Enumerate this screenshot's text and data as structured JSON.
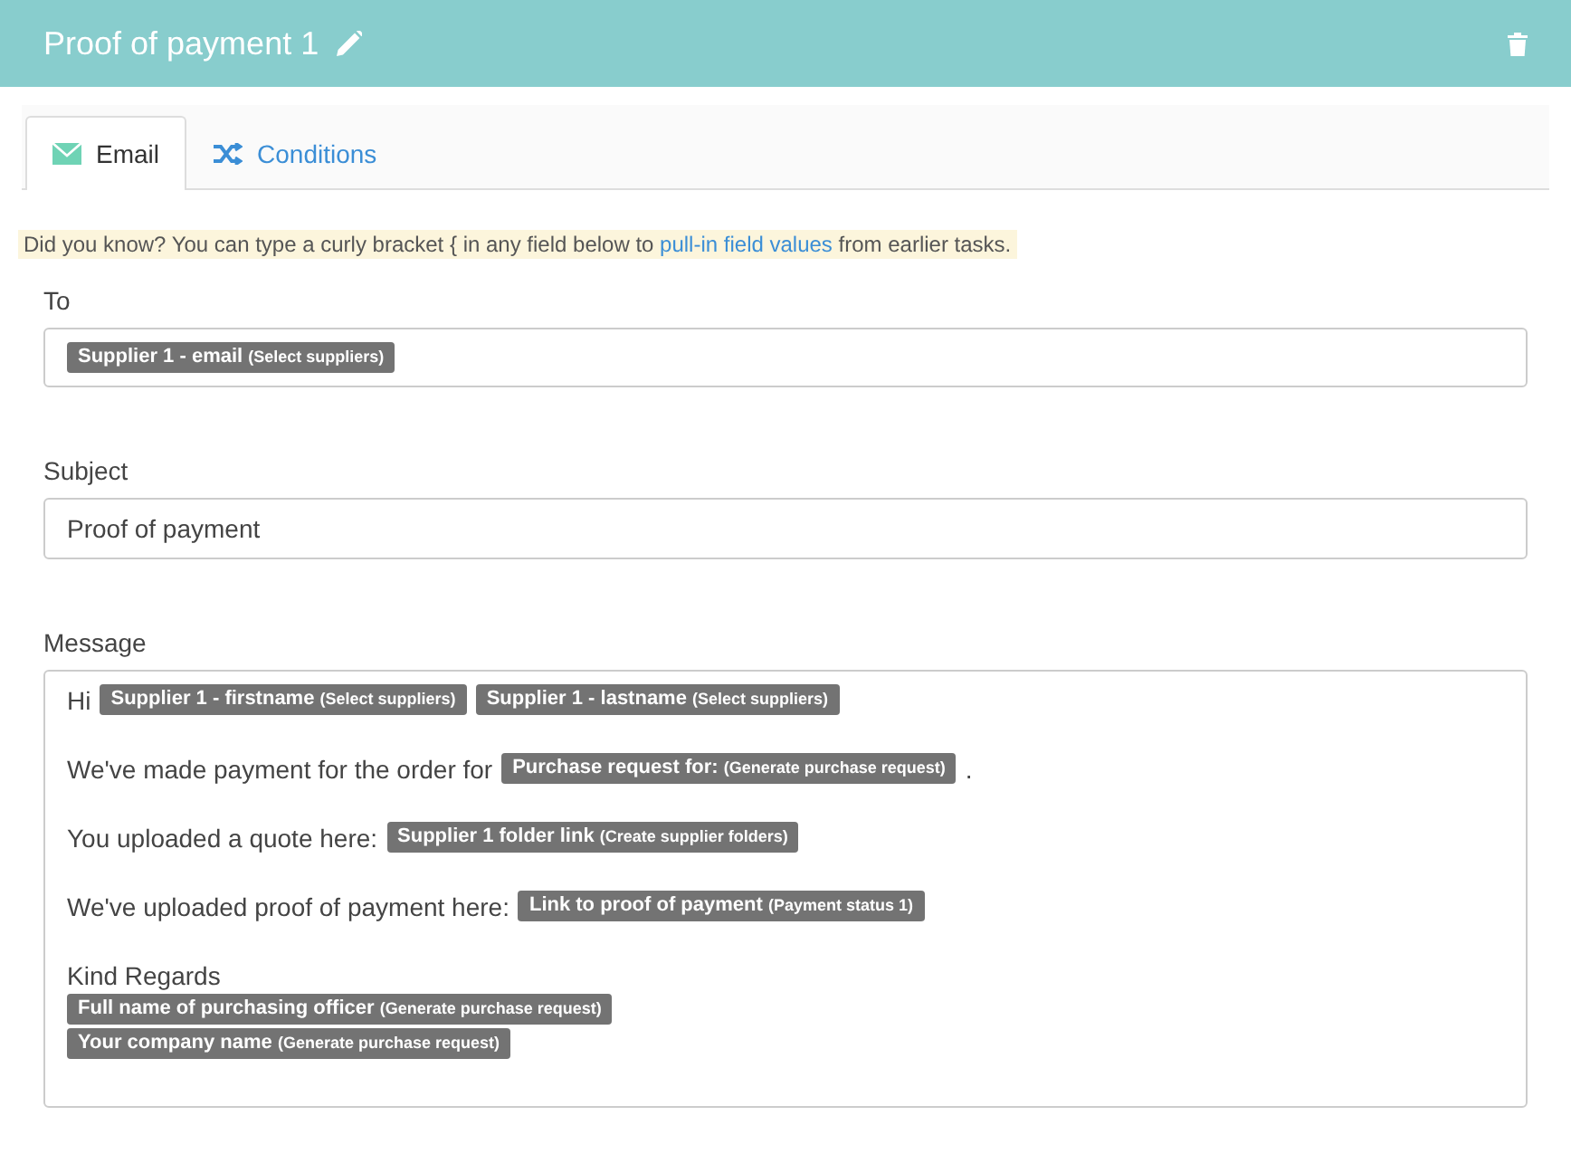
{
  "header": {
    "title": "Proof of payment 1"
  },
  "tabs": [
    {
      "label": "Email",
      "kind": "email",
      "selected": true
    },
    {
      "label": "Conditions",
      "kind": "conditions",
      "selected": false
    }
  ],
  "tip": {
    "before": "Did you know? You can type a curly bracket { in any field below to ",
    "link": "pull-in field values",
    "after": " from earlier tasks."
  },
  "to": {
    "label": "To",
    "tokens": [
      {
        "field": "Supplier 1 - email",
        "source": "(Select suppliers)"
      }
    ]
  },
  "subject": {
    "label": "Subject",
    "value": "Proof of payment"
  },
  "message": {
    "label": "Message",
    "paragraphs": [
      [
        [
          {
            "kind": "text",
            "text": "Hi"
          },
          {
            "kind": "token",
            "field": "Supplier 1 - firstname",
            "source": "(Select suppliers)"
          },
          {
            "kind": "token",
            "field": "Supplier 1 - lastname",
            "source": "(Select suppliers)"
          }
        ]
      ],
      [
        [
          {
            "kind": "text",
            "text": "We've made payment for the order for"
          },
          {
            "kind": "token",
            "field": "Purchase request for:",
            "source": "(Generate purchase request)"
          },
          {
            "kind": "text",
            "text": "."
          }
        ]
      ],
      [
        [
          {
            "kind": "text",
            "text": "You uploaded a quote here:"
          },
          {
            "kind": "token",
            "field": "Supplier 1 folder link",
            "source": "(Create supplier folders)"
          }
        ]
      ],
      [
        [
          {
            "kind": "text",
            "text": "We've uploaded proof of payment here:"
          },
          {
            "kind": "token",
            "field": "Link to proof of payment",
            "source": "(Payment status 1)"
          }
        ]
      ],
      [
        [
          {
            "kind": "text",
            "text": "Kind Regards"
          }
        ],
        [
          {
            "kind": "token",
            "field": "Full name of purchasing officer",
            "source": "(Generate purchase request)"
          }
        ],
        [
          {
            "kind": "token",
            "field": "Your company name",
            "source": "(Generate purchase request)"
          }
        ]
      ]
    ]
  }
}
